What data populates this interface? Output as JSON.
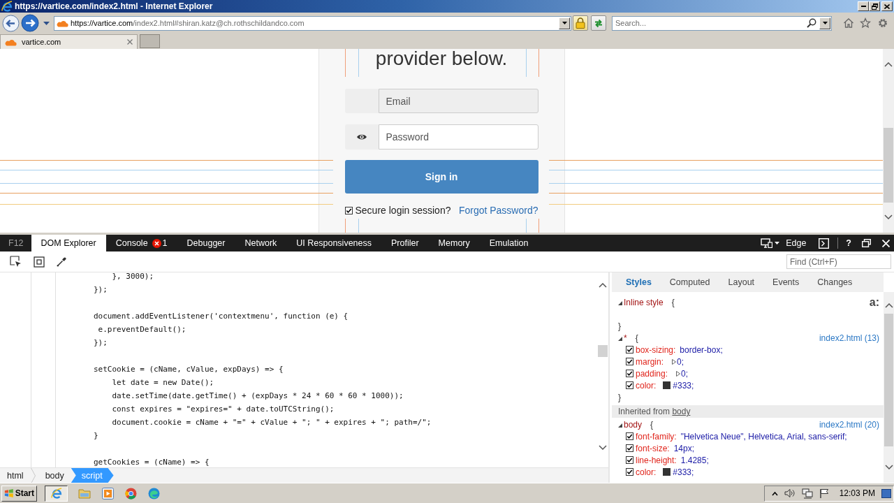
{
  "window": {
    "title": "https://vartice.com/index2.html - Internet Explorer"
  },
  "address_bar": {
    "url": {
      "host": "https://vartice.com",
      "path": "/index2.html#shiran.katz@ch.rothschildandco.com"
    }
  },
  "search": {
    "placeholder": "Search..."
  },
  "tabs": [
    {
      "label": "vartice.com",
      "selected": true
    }
  ],
  "page": {
    "heading": "provider below.",
    "fields": [
      {
        "kind": "email",
        "placeholder": "Email",
        "readonly": true
      },
      {
        "kind": "password",
        "placeholder": "Password",
        "readonly": false
      }
    ],
    "sign_in": "Sign in",
    "remember": {
      "label": "Secure login session?",
      "checked": true
    },
    "forgot_link": "Forgot Password?"
  },
  "devtools": {
    "label": "F12",
    "tabs": [
      {
        "label": "DOM Explorer",
        "selected": true
      },
      {
        "label": "Console",
        "selected": false,
        "errors": "1"
      },
      {
        "label": "Debugger",
        "selected": false
      },
      {
        "label": "Network",
        "selected": false
      },
      {
        "label": "UI Responsiveness",
        "selected": false
      },
      {
        "label": "Profiler",
        "selected": false
      },
      {
        "label": "Memory",
        "selected": false
      },
      {
        "label": "Emulation",
        "selected": false
      }
    ],
    "document_mode": "Edge",
    "help": "?",
    "find": {
      "placeholder": "Find (Ctrl+F)"
    }
  },
  "code_blocks": [
    [
      "    }, 3000);",
      "});"
    ],
    [
      "document.addEventListener('contextmenu', function (e) {",
      " e.preventDefault();",
      "});"
    ],
    [
      "setCookie = (cName, cValue, expDays) => {",
      "    let date = new Date();",
      "    date.setTime(date.getTime() + (expDays * 24 * 60 * 60 * 1000));",
      "    const expires = \"expires=\" + date.toUTCString();",
      "    document.cookie = cName + \"=\" + cValue + \"; \" + expires + \"; path=/\";",
      "}"
    ],
    [
      "getCookies = (cName) => {"
    ]
  ],
  "breadcrumb": [
    {
      "label": "html",
      "selected": false
    },
    {
      "label": "body",
      "selected": false
    },
    {
      "label": "script",
      "selected": true
    }
  ],
  "styles_panel": {
    "tabs": [
      {
        "label": "Styles",
        "selected": true
      },
      {
        "label": "Computed",
        "selected": false
      },
      {
        "label": "Layout",
        "selected": false
      },
      {
        "label": "Events",
        "selected": false
      },
      {
        "label": "Changes",
        "selected": false
      }
    ],
    "pseudo_toggle": "a:",
    "rules": [
      {
        "kind": "rule",
        "expanded": true,
        "selector": "Inline style",
        "open": "{",
        "close": "}"
      },
      {
        "kind": "rule",
        "expanded": true,
        "selector": "*",
        "open": "{",
        "source": "index2.html (13)",
        "declarations": [
          {
            "property": "box-sizing:",
            "value": "border-box;",
            "checked": true
          },
          {
            "property": "margin:",
            "value": "0;",
            "expandable": true,
            "checked": true
          },
          {
            "property": "padding:",
            "value": "0;",
            "expandable": true,
            "checked": true
          },
          {
            "property": "color:",
            "value": "#333;",
            "color": "#333333",
            "checked": true
          }
        ],
        "close": "}"
      },
      {
        "kind": "inherited",
        "label": "Inherited from",
        "element": "body"
      },
      {
        "kind": "rule",
        "expanded": true,
        "selector": "body",
        "open": "{",
        "source": "index2.html (20)",
        "declarations": [
          {
            "property": "font-family:",
            "value": "\"Helvetica Neue\", Helvetica, Arial, sans-serif;",
            "checked": true
          },
          {
            "property": "font-size:",
            "value": "14px;",
            "checked": true
          },
          {
            "property": "line-height:",
            "value": "1.4285;",
            "checked": true
          },
          {
            "property": "color:",
            "value": "#333;",
            "color": "#333333",
            "checked": true
          }
        ]
      }
    ]
  },
  "taskbar": {
    "start": "Start",
    "browser_button": {
      "selected": true
    },
    "clock": "12:03 PM"
  }
}
